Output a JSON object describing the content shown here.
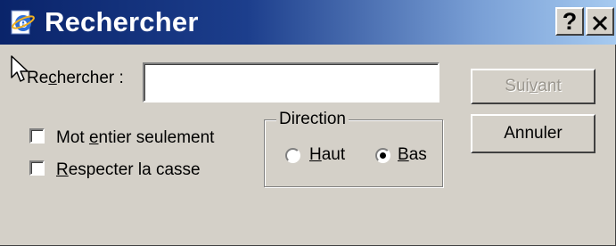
{
  "dialog": {
    "title": "Rechercher",
    "help_button": "?",
    "close_icon": "close-icon",
    "app_icon": "ie-icon"
  },
  "search": {
    "label_pre": "Re",
    "label_key": "c",
    "label_post": "hercher :",
    "value": "",
    "placeholder": ""
  },
  "options": {
    "whole_word": {
      "pre": "Mot ",
      "key": "e",
      "post": "ntier seulement",
      "checked": false
    },
    "match_case": {
      "pre": "",
      "key": "R",
      "post": "especter la casse",
      "checked": false
    }
  },
  "direction": {
    "legend": "Direction",
    "up": {
      "pre": "",
      "key": "H",
      "post": "aut",
      "selected": false
    },
    "down": {
      "pre": "",
      "key": "B",
      "post": "as",
      "selected": true
    }
  },
  "buttons": {
    "next": {
      "pre": "Sui",
      "key": "v",
      "post": "ant",
      "enabled": false
    },
    "cancel": {
      "label": "Annuler"
    }
  },
  "colors": {
    "face": "#d4d0c8",
    "title_start": "#0a246a",
    "title_end": "#a6caf0",
    "disabled_text": "#9a968e"
  }
}
